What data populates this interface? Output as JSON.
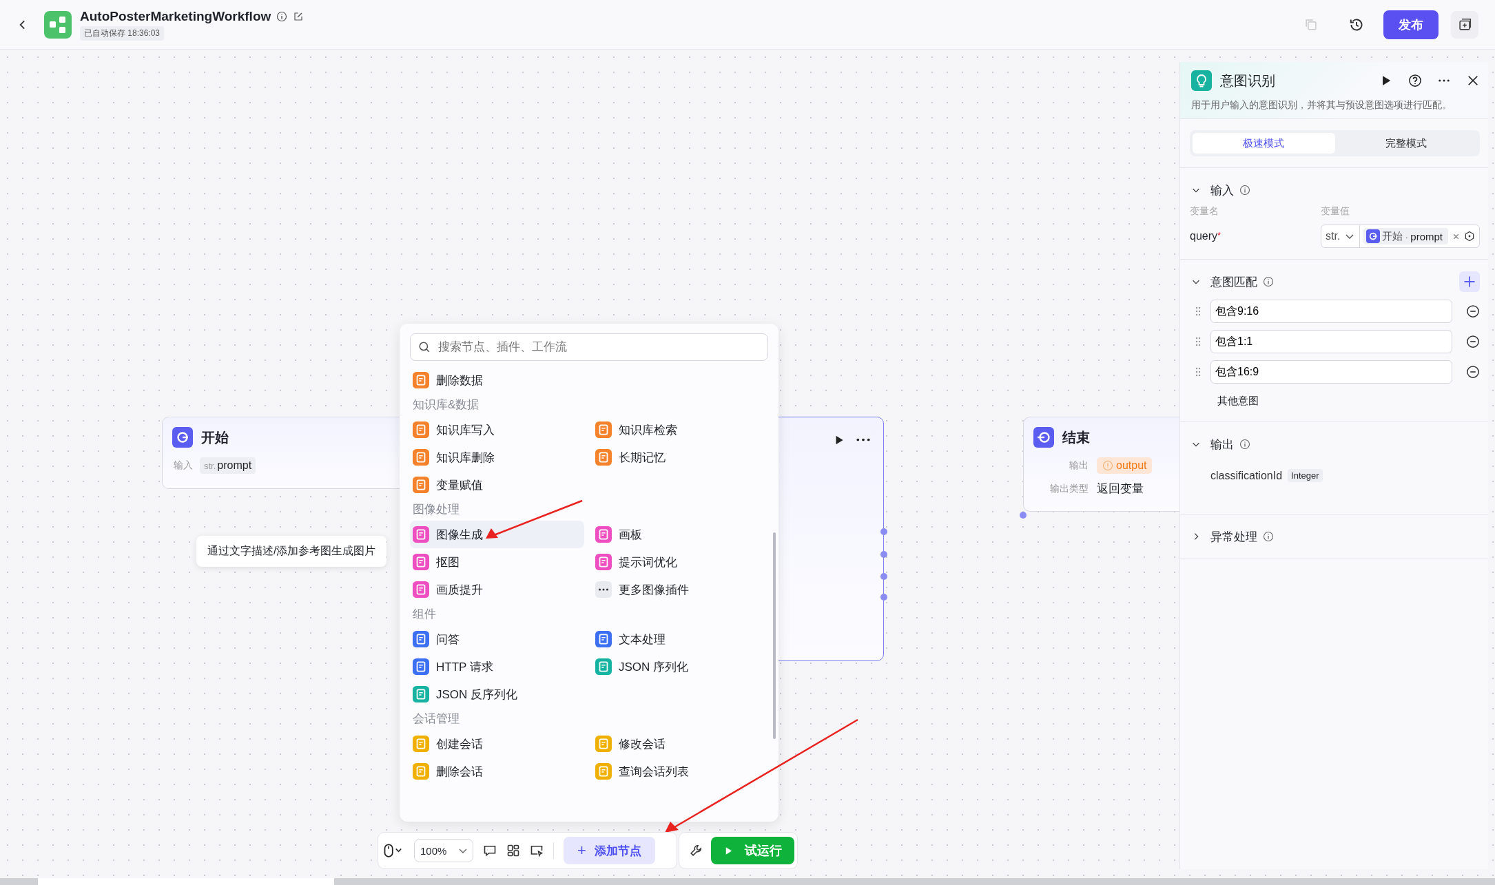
{
  "header": {
    "title": "AutoPosterMarketingWorkflow",
    "autosave": "已自动保存 18:36:03",
    "publish": "发布"
  },
  "start_node": {
    "title": "开始",
    "input_label": "输入",
    "input_type": "str.",
    "input_name": "prompt"
  },
  "end_node": {
    "title": "结束",
    "output_label": "输出",
    "output_value": "output",
    "output_type_label": "输出类型",
    "output_type": "返回变量"
  },
  "tooltip": "通过文字描述/添加参考图生成图片",
  "node_menu": {
    "search_placeholder": "搜索节点、插件、工作流",
    "groups": [
      {
        "items": [
          {
            "label": "删除数据",
            "kind": "node",
            "color": "#f5822a",
            "selected": false
          }
        ]
      },
      {
        "title": "知识库&数据",
        "items": [
          {
            "label": "知识库写入",
            "kind": "node",
            "color": "#f5822a",
            "selected": false
          },
          {
            "label": "知识库检索",
            "kind": "node",
            "color": "#f5822a",
            "selected": false
          },
          {
            "label": "知识库删除",
            "kind": "node",
            "color": "#f5822a",
            "selected": false
          },
          {
            "label": "长期记忆",
            "kind": "node",
            "color": "#f5822a",
            "selected": false
          },
          {
            "label": "变量赋值",
            "kind": "node",
            "color": "#f5822a",
            "selected": false
          }
        ]
      },
      {
        "title": "图像处理",
        "items": [
          {
            "label": "图像生成",
            "kind": "node",
            "color": "#ee4fc0",
            "selected": true
          },
          {
            "label": "画板",
            "kind": "node",
            "color": "#ee4fc0",
            "selected": false
          },
          {
            "label": "抠图",
            "kind": "node",
            "color": "#ee4fc0",
            "selected": false
          },
          {
            "label": "提示词优化",
            "kind": "node",
            "color": "#ee4fc0",
            "selected": false
          },
          {
            "label": "画质提升",
            "kind": "node",
            "color": "#ee4fc0",
            "selected": false
          },
          {
            "label": "更多图像插件",
            "kind": "more",
            "color": "#e8eaf0",
            "selected": false
          }
        ]
      },
      {
        "title": "组件",
        "items": [
          {
            "label": "问答",
            "kind": "node",
            "color": "#3d6ff2",
            "selected": false
          },
          {
            "label": "文本处理",
            "kind": "node",
            "color": "#3d6ff2",
            "selected": false
          },
          {
            "label": "HTTP 请求",
            "kind": "node",
            "color": "#3d6ff2",
            "selected": false
          },
          {
            "label": "JSON 序列化",
            "kind": "node",
            "color": "#16b3a3",
            "selected": false
          },
          {
            "label": "JSON 反序列化",
            "kind": "node",
            "color": "#16b3a3",
            "selected": false
          }
        ]
      },
      {
        "title": "会话管理",
        "items": [
          {
            "label": "创建会话",
            "kind": "node",
            "color": "#f0b000",
            "selected": false
          },
          {
            "label": "修改会话",
            "kind": "node",
            "color": "#f0b000",
            "selected": false
          },
          {
            "label": "删除会话",
            "kind": "node",
            "color": "#f0b000",
            "selected": false
          },
          {
            "label": "查询会话列表",
            "kind": "node",
            "color": "#f0b000",
            "selected": false
          }
        ]
      }
    ]
  },
  "toolbar": {
    "zoom": "100%",
    "add_symbol": "+",
    "add_node": "添加节点",
    "test_run": "试运行"
  },
  "panel": {
    "title": "意图识别",
    "description": "用于用户输入的意图识别，并将其与预设意图选项进行匹配。",
    "tabs": [
      {
        "label": "极速模式",
        "selected": true
      },
      {
        "label": "完整模式",
        "selected": false
      }
    ],
    "sections": [
      {
        "kind": "input",
        "title": "输入",
        "expanded": true,
        "columns": [
          "变量名",
          "变量值"
        ],
        "rows": [
          {
            "name": "query",
            "required_mark": "*",
            "type": "str.",
            "ref_node": "开始",
            "separator": "·",
            "ref_var": "prompt"
          }
        ]
      },
      {
        "kind": "intents",
        "title": "意图匹配",
        "expanded": true,
        "intents": [
          "包含9:16",
          "包含1:1",
          "包含16:9"
        ],
        "other": "其他意图"
      },
      {
        "kind": "output",
        "title": "输出",
        "expanded": true,
        "outputs": [
          {
            "name": "classificationId",
            "type": "Integer"
          }
        ]
      },
      {
        "kind": "error",
        "title": "异常处理",
        "expanded": false
      }
    ]
  }
}
